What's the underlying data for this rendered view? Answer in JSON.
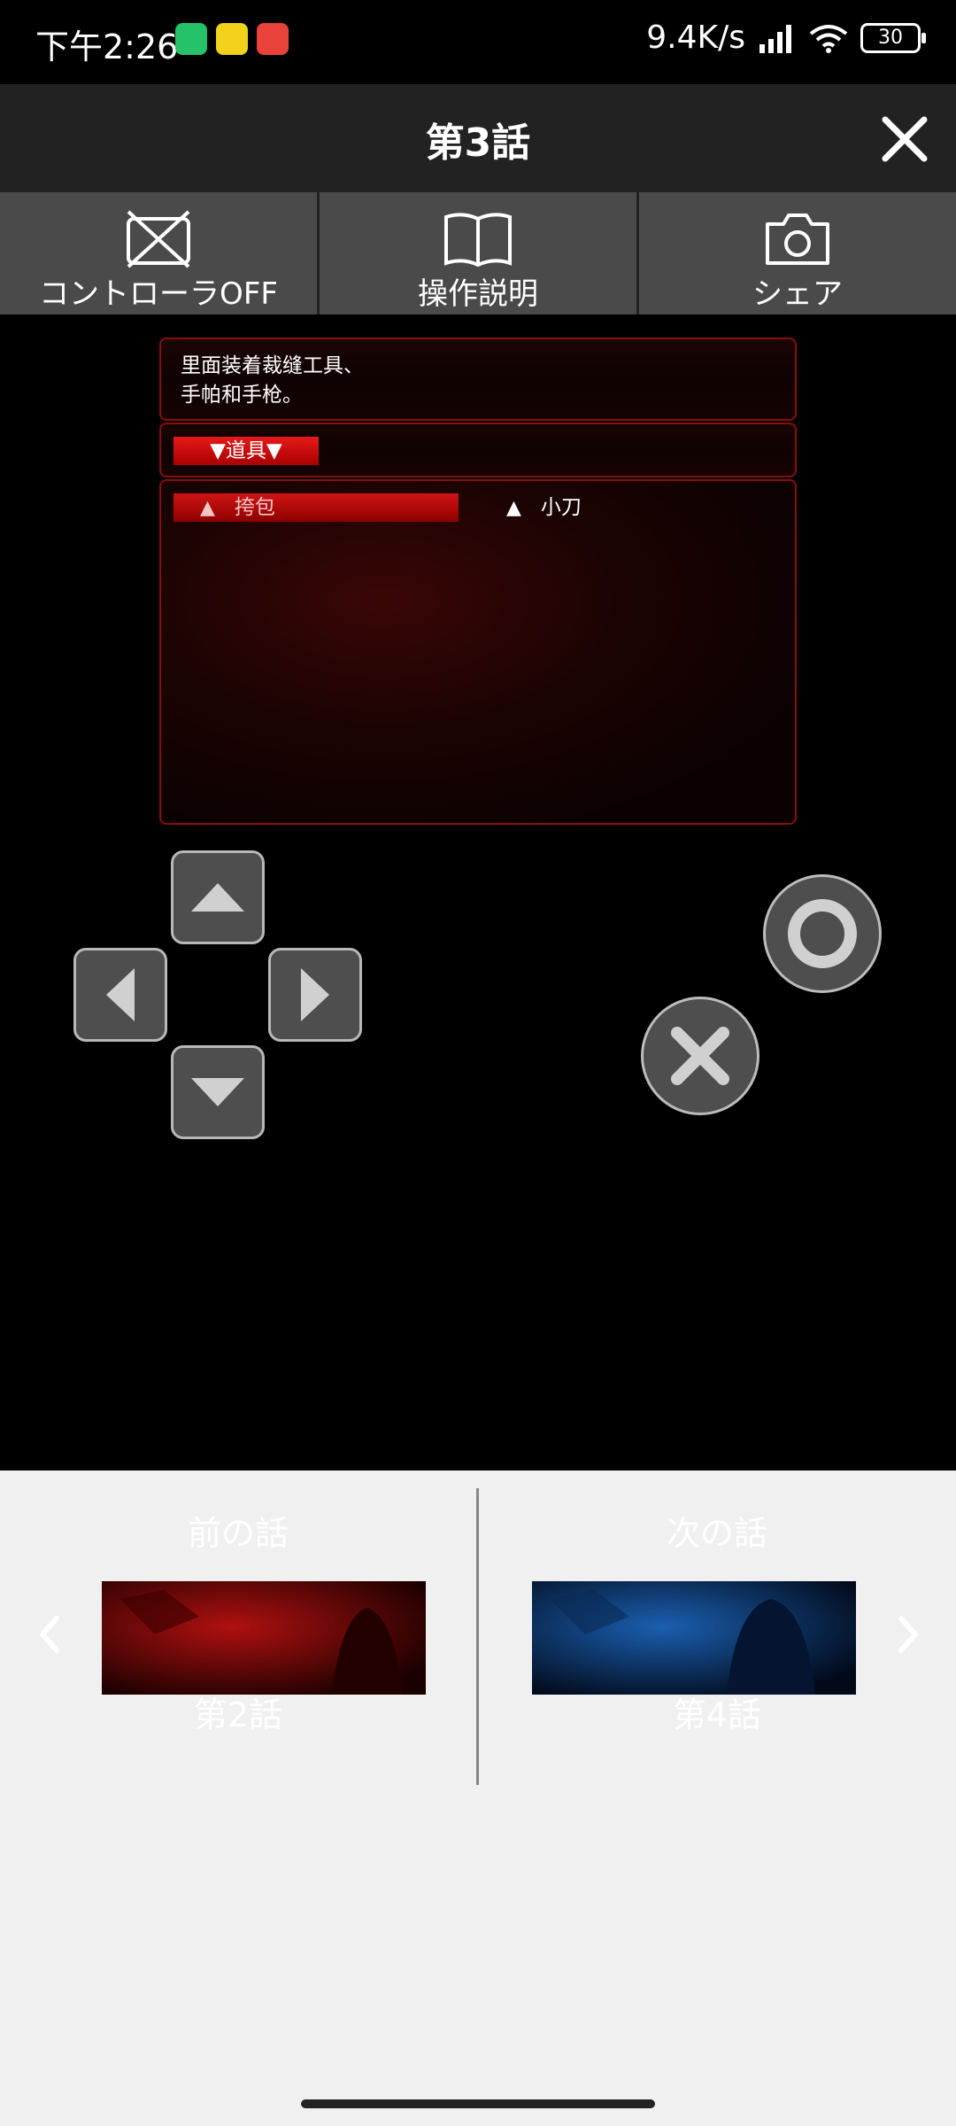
{
  "status_bar": {
    "time": "下午2:26",
    "net_speed": "9.4K/s",
    "battery": "30"
  },
  "header": {
    "title": "第3話"
  },
  "toolbar": {
    "items": [
      {
        "label": "コントローラOFF",
        "icon": "controller-off-icon"
      },
      {
        "label": "操作説明",
        "icon": "book-icon"
      },
      {
        "label": "シェア",
        "icon": "camera-icon"
      }
    ]
  },
  "game": {
    "description_line1": "里面装着裁缝工具、",
    "description_line2": "手帕和手枪。",
    "category_label": "▼道具▼",
    "items": [
      {
        "label": "挎包",
        "selected": true
      },
      {
        "label": "小刀",
        "selected": false
      }
    ]
  },
  "episode_nav": {
    "prev_heading": "前の話",
    "prev_title": "第2話",
    "next_heading": "次の話",
    "next_title": "第4話"
  },
  "colors": {
    "accent_red": "#d01414",
    "panel_border": "#8a0e0e",
    "toolbar_bg": "#4a4a4a"
  }
}
